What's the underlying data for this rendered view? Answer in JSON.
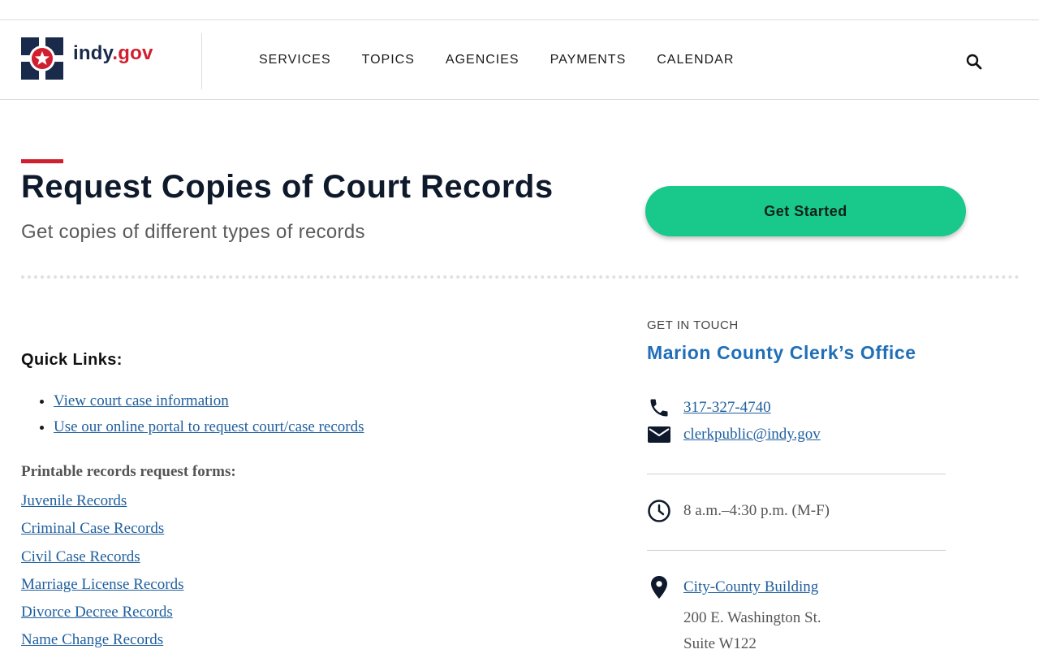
{
  "brand": {
    "prefix": "indy",
    "dot": ".",
    "suffix": "gov"
  },
  "nav": [
    "SERVICES",
    "TOPICS",
    "AGENCIES",
    "PAYMENTS",
    "CALENDAR"
  ],
  "icons": {
    "search": "search-icon",
    "phone": "phone-icon",
    "email": "email-icon",
    "clock": "clock-icon",
    "location": "location-pin-icon"
  },
  "colors": {
    "accent_red": "#d01f2f",
    "cta_green": "#18c98b",
    "link_blue": "#1f5f9e",
    "office_blue": "#1f6fb8",
    "navy": "#1a2a4a"
  },
  "page": {
    "title": "Request Copies of Court Records",
    "subtitle": "Get copies of different types of records",
    "cta_label": "Get Started"
  },
  "quick_links": {
    "title": "Quick Links:",
    "items": [
      "View court case information",
      "Use our online portal to request court/case records"
    ]
  },
  "forms": {
    "title": "Printable records request forms:",
    "items": [
      "Juvenile Records",
      "Criminal Case Records",
      "Civil Case Records",
      "Marriage License Records",
      "Divorce Decree Records",
      "Name Change Records"
    ]
  },
  "contact": {
    "label": "GET IN TOUCH",
    "office": "Marion County Clerk’s Office",
    "phone": "317-327-4740",
    "email": "clerkpublic@indy.gov",
    "hours": "8 a.m.–4:30 p.m. (M-F)",
    "location_name": "City-County Building",
    "address_line1": "200 E. Washington St.",
    "address_line2": "Suite W122"
  }
}
